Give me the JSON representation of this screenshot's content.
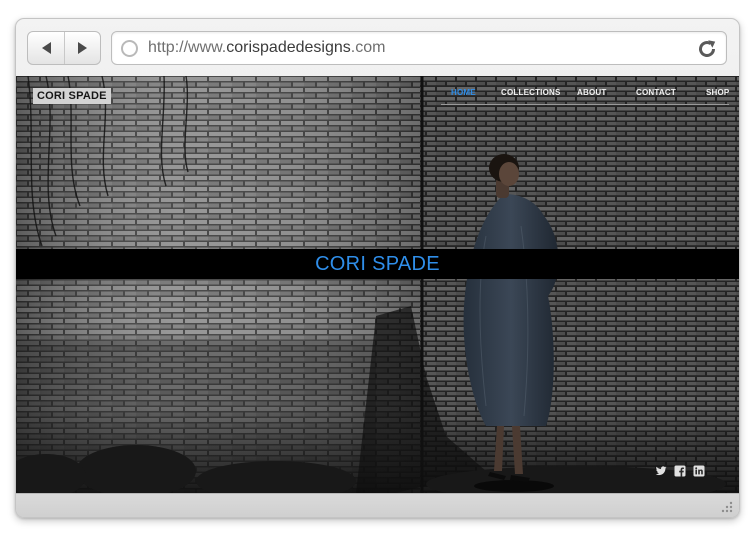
{
  "browser": {
    "url_prefix": "http://www.",
    "url_domain": "corispadedesigns",
    "url_suffix": ".com"
  },
  "site": {
    "logo": "CORI SPADE",
    "title": "CORI SPADE",
    "nav": [
      {
        "label": "HOME",
        "active": true
      },
      {
        "label": "COLLECTIONS",
        "active": false
      },
      {
        "label": "ABOUT",
        "active": false
      },
      {
        "label": "CONTACT",
        "active": false
      },
      {
        "label": "SHOP",
        "active": false
      }
    ],
    "social_icons": [
      "twitter-icon",
      "facebook-icon",
      "linkedin-icon"
    ]
  },
  "colors": {
    "accent": "#2f8ee9",
    "band": "#000000",
    "chrome": "#e6e6e6"
  }
}
